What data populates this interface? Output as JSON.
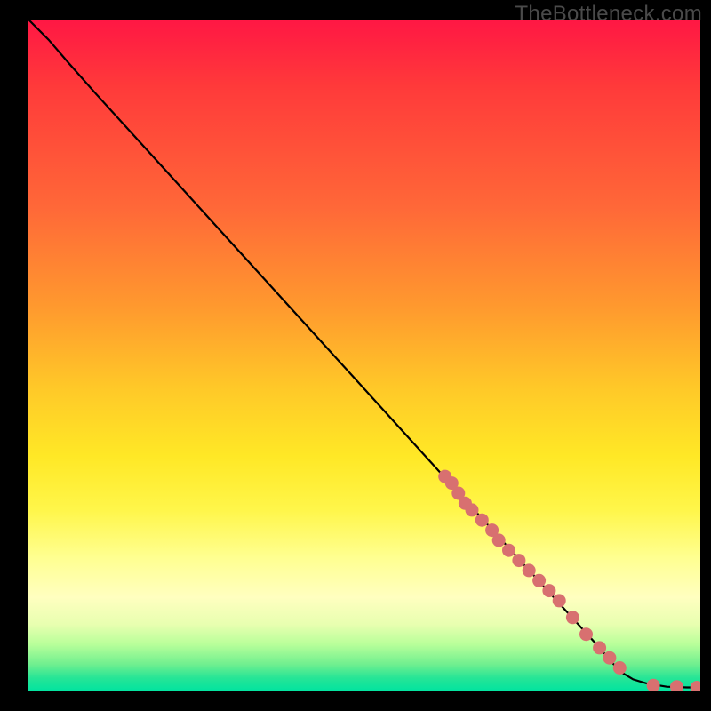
{
  "watermark": "TheBottleneck.com",
  "chart_data": {
    "type": "line",
    "title": "",
    "xlabel": "",
    "ylabel": "",
    "xlim": [
      0,
      100
    ],
    "ylim": [
      0,
      100
    ],
    "grid": false,
    "legend": false,
    "background_gradient": {
      "stops": [
        {
          "pos": 0,
          "color": "#ff1744"
        },
        {
          "pos": 10,
          "color": "#ff3a3a"
        },
        {
          "pos": 28,
          "color": "#ff6838"
        },
        {
          "pos": 43,
          "color": "#ff9a2e"
        },
        {
          "pos": 55,
          "color": "#ffc928"
        },
        {
          "pos": 65,
          "color": "#ffe826"
        },
        {
          "pos": 73,
          "color": "#fff64a"
        },
        {
          "pos": 80,
          "color": "#ffff90"
        },
        {
          "pos": 86,
          "color": "#ffffc0"
        },
        {
          "pos": 90,
          "color": "#e8ffb0"
        },
        {
          "pos": 93,
          "color": "#b8ff9a"
        },
        {
          "pos": 96,
          "color": "#6fef8f"
        },
        {
          "pos": 98,
          "color": "#26e596"
        },
        {
          "pos": 100,
          "color": "#00e3a0"
        }
      ]
    },
    "series": [
      {
        "name": "bottleneck-curve",
        "type": "line",
        "color": "#000000",
        "x": [
          0,
          3,
          6,
          10,
          20,
          30,
          40,
          50,
          60,
          70,
          80,
          85,
          88,
          90,
          92,
          95,
          98,
          100
        ],
        "y": [
          100,
          97,
          93.5,
          89,
          78,
          67,
          56,
          45,
          34,
          23,
          12,
          6.5,
          3,
          1.8,
          1.2,
          0.7,
          0.6,
          0.6
        ]
      },
      {
        "name": "data-points",
        "type": "scatter",
        "color": "#d87070",
        "x": [
          62,
          63,
          64,
          65,
          66,
          67.5,
          69,
          70,
          71.5,
          73,
          74.5,
          76,
          77.5,
          79,
          81,
          83,
          85,
          86.5,
          88,
          93,
          96.5,
          99.5
        ],
        "y": [
          32,
          31,
          29.5,
          28,
          27,
          25.5,
          24,
          22.5,
          21,
          19.5,
          18,
          16.5,
          15,
          13.5,
          11,
          8.5,
          6.5,
          5,
          3.5,
          0.9,
          0.7,
          0.6
        ]
      }
    ]
  }
}
